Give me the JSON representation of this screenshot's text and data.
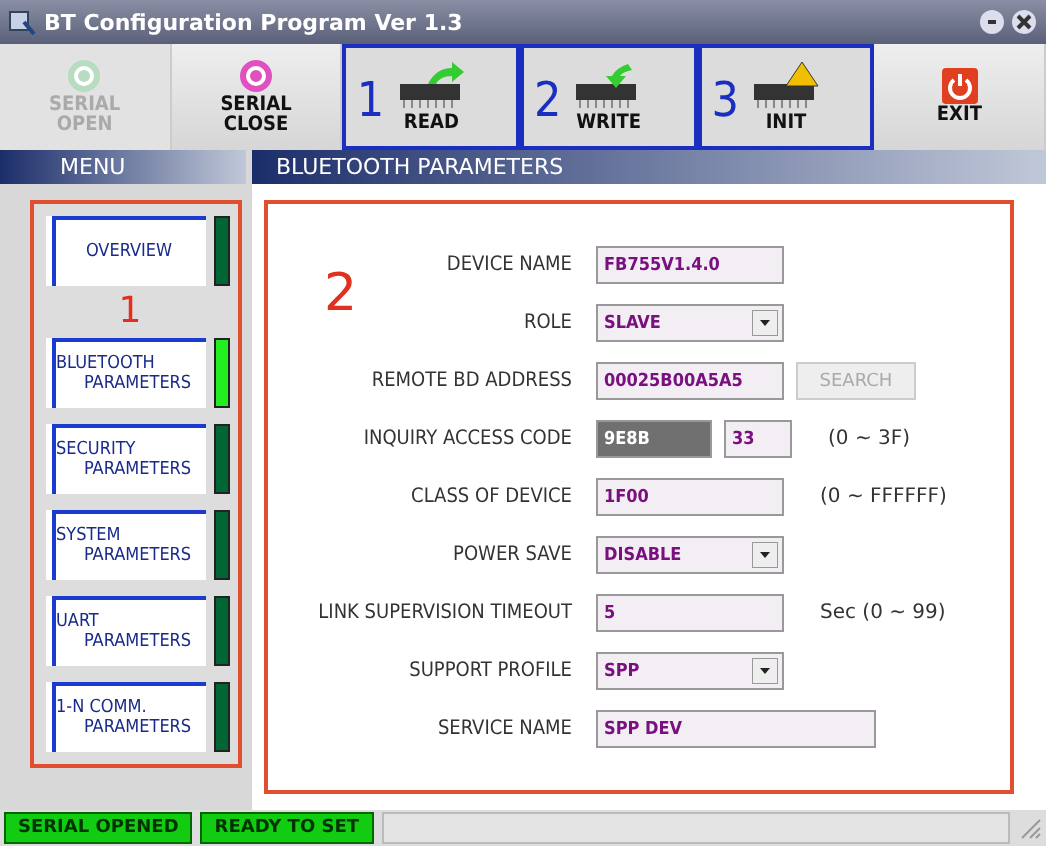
{
  "window": {
    "title": "BT Configuration Program Ver 1.3"
  },
  "toolbar": [
    {
      "kind": "open",
      "lines": [
        "SERIAL",
        "OPEN"
      ],
      "disabled": true
    },
    {
      "kind": "close",
      "lines": [
        "SERIAL",
        "CLOSE"
      ],
      "disabled": false
    },
    {
      "kind": "read",
      "lines": [
        "READ"
      ],
      "disabled": false,
      "callout": "1"
    },
    {
      "kind": "write",
      "lines": [
        "WRITE"
      ],
      "disabled": false,
      "callout": "2"
    },
    {
      "kind": "init",
      "lines": [
        "INIT"
      ],
      "disabled": false,
      "callout": "3"
    },
    {
      "kind": "exit",
      "lines": [
        "EXIT"
      ],
      "disabled": false
    }
  ],
  "menu": {
    "title": "MENU",
    "callout": "1",
    "items": [
      {
        "lines": [
          "OVERVIEW"
        ],
        "selected": false
      },
      {
        "lines": [
          "BLUETOOTH",
          "PARAMETERS"
        ],
        "selected": true
      },
      {
        "lines": [
          "SECURITY",
          "PARAMETERS"
        ],
        "selected": false
      },
      {
        "lines": [
          "SYSTEM",
          "PARAMETERS"
        ],
        "selected": false
      },
      {
        "lines": [
          "UART",
          "PARAMETERS"
        ],
        "selected": false
      },
      {
        "lines": [
          "1-N COMM.",
          "PARAMETERS"
        ],
        "selected": false
      }
    ]
  },
  "panel": {
    "title": "BLUETOOTH PARAMETERS",
    "callout": "2",
    "rows": [
      {
        "kind": "text",
        "label": "DEVICE NAME",
        "value": "FB755V1.4.0"
      },
      {
        "kind": "select",
        "label": "ROLE",
        "value": "SLAVE"
      },
      {
        "kind": "button",
        "label": "REMOTE BD ADDRESS",
        "value": "00025B00A5A5",
        "button": "SEARCH",
        "disabled": true
      },
      {
        "kind": "pair",
        "label": "INQUIRY ACCESS CODE",
        "value": "9E8B",
        "value2": "33",
        "hint": "(0 ~ 3F)"
      },
      {
        "kind": "text",
        "label": "CLASS OF DEVICE",
        "value": "1F00",
        "hint": "(0 ~ FFFFFF)"
      },
      {
        "kind": "select",
        "label": "POWER SAVE",
        "value": "DISABLE"
      },
      {
        "kind": "text",
        "label": "LINK SUPERVISION TIMEOUT",
        "value": "5",
        "hint": "Sec (0 ~ 99)"
      },
      {
        "kind": "select",
        "label": "SUPPORT PROFILE",
        "value": "SPP"
      },
      {
        "kind": "wide",
        "label": "SERVICE NAME",
        "value": "SPP DEV"
      }
    ]
  },
  "status_bar": [
    "SERIAL OPENED",
    "READY TO SET"
  ]
}
